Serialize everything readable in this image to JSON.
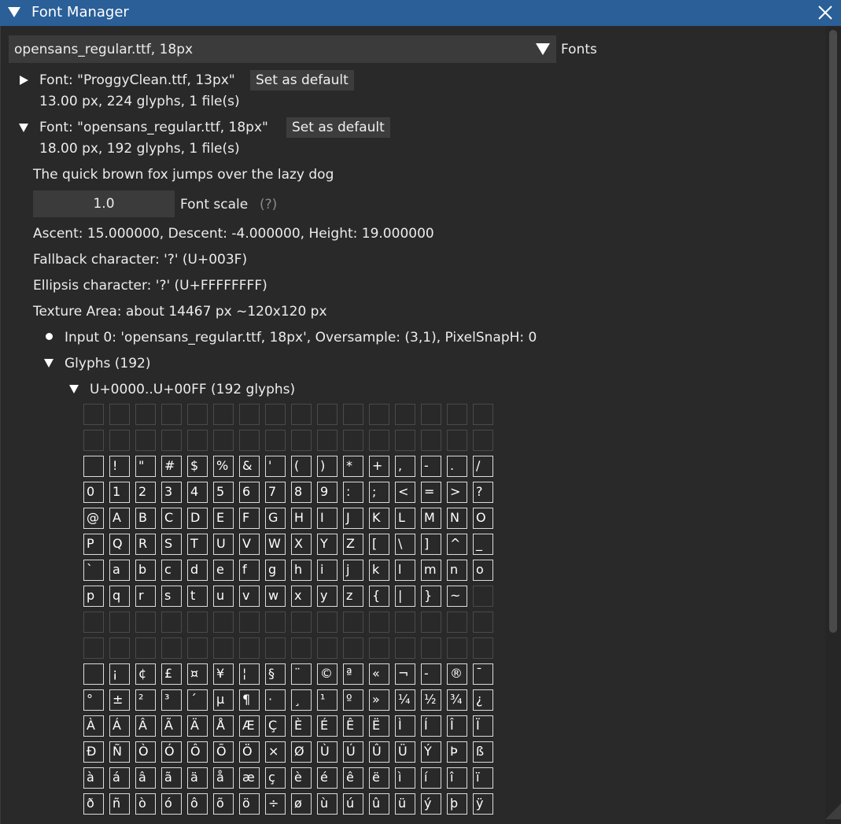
{
  "window": {
    "title": "Font Manager",
    "colors": {
      "titlebar": "#2a5f98",
      "body": "#292929",
      "frame": "#3b3b3b"
    }
  },
  "combo": {
    "value": "opensans_regular.ttf, 18px",
    "label": "Fonts"
  },
  "fonts": [
    {
      "label": "Font: \"ProggyClean.ttf, 13px\"",
      "button": "Set as default",
      "info": "13.00 px, 224 glyphs, 1 file(s)",
      "expanded": false
    },
    {
      "label": "Font: \"opensans_regular.ttf, 18px\"",
      "button": "Set as default",
      "info": "18.00 px, 192 glyphs, 1 file(s)",
      "expanded": true
    }
  ],
  "details": {
    "sample": "The quick brown fox jumps over the lazy dog",
    "scale_value": "1.0",
    "scale_label": "Font scale",
    "help_marker": "(?)",
    "metrics": "Ascent: 15.000000, Descent: -4.000000, Height: 19.000000",
    "fallback": "Fallback character: '?' (U+003F)",
    "ellipsis": "Ellipsis character: '?' (U+FFFFFFFF)",
    "texture": "Texture Area: about 14467 px ~120x120 px",
    "input": "Input 0: 'opensans_regular.ttf, 18px', Oversample: (3,1), PixelSnapH: 0",
    "glyphs_node": "Glyphs (192)",
    "range_node": "U+0000..U+00FF (192 glyphs)"
  },
  "glyph_rows": [
    "",
    "",
    " !\"#$%&'()*+,-./",
    "0123456789:;<=>?",
    "@ABCDEFGHIJKLMNO",
    "PQRSTUVWXYZ[\\]^_",
    "`abcdefghijklmno",
    "pqrstuvwxyz{|}~",
    "",
    "",
    " ¡¢£¤¥¦§¨©ª«¬-®¯",
    "°±²³´µ¶·¸¹º»¼½¾¿",
    "ÀÁÂÃÄÅÆÇÈÉÊËÌÍÎÏ",
    "ÐÑÒÓÔÕÖ×ØÙÚÛÜÝÞß",
    "àáâãäåæçèéêëìíîï",
    "ðñòóôõö÷øùúûüýþÿ"
  ]
}
